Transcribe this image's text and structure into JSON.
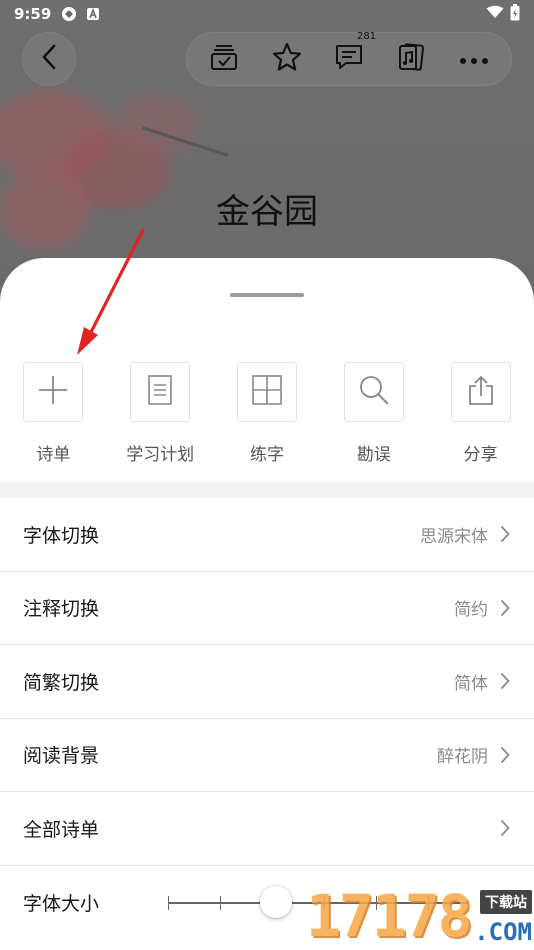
{
  "status_bar": {
    "time": "9:59"
  },
  "poem": {
    "title": "金谷园"
  },
  "toolbar": {
    "comment_count": "281"
  },
  "actions": [
    {
      "label": "诗单",
      "icon": "plus-icon"
    },
    {
      "label": "学习计划",
      "icon": "document-icon"
    },
    {
      "label": "练字",
      "icon": "grid-icon"
    },
    {
      "label": "勘误",
      "icon": "search-icon"
    },
    {
      "label": "分享",
      "icon": "share-icon"
    }
  ],
  "settings": [
    {
      "label": "字体切换",
      "value": "思源宋体"
    },
    {
      "label": "注释切换",
      "value": "简约"
    },
    {
      "label": "简繁切换",
      "value": "简体"
    },
    {
      "label": "阅读背景",
      "value": "醉花阴"
    },
    {
      "label": "全部诗单",
      "value": ""
    }
  ],
  "font_size": {
    "label": "字体大小",
    "level_fraction": 0.36
  },
  "watermark": {
    "digits": "17178",
    "tag": "下载站",
    "domain": ".COM"
  }
}
